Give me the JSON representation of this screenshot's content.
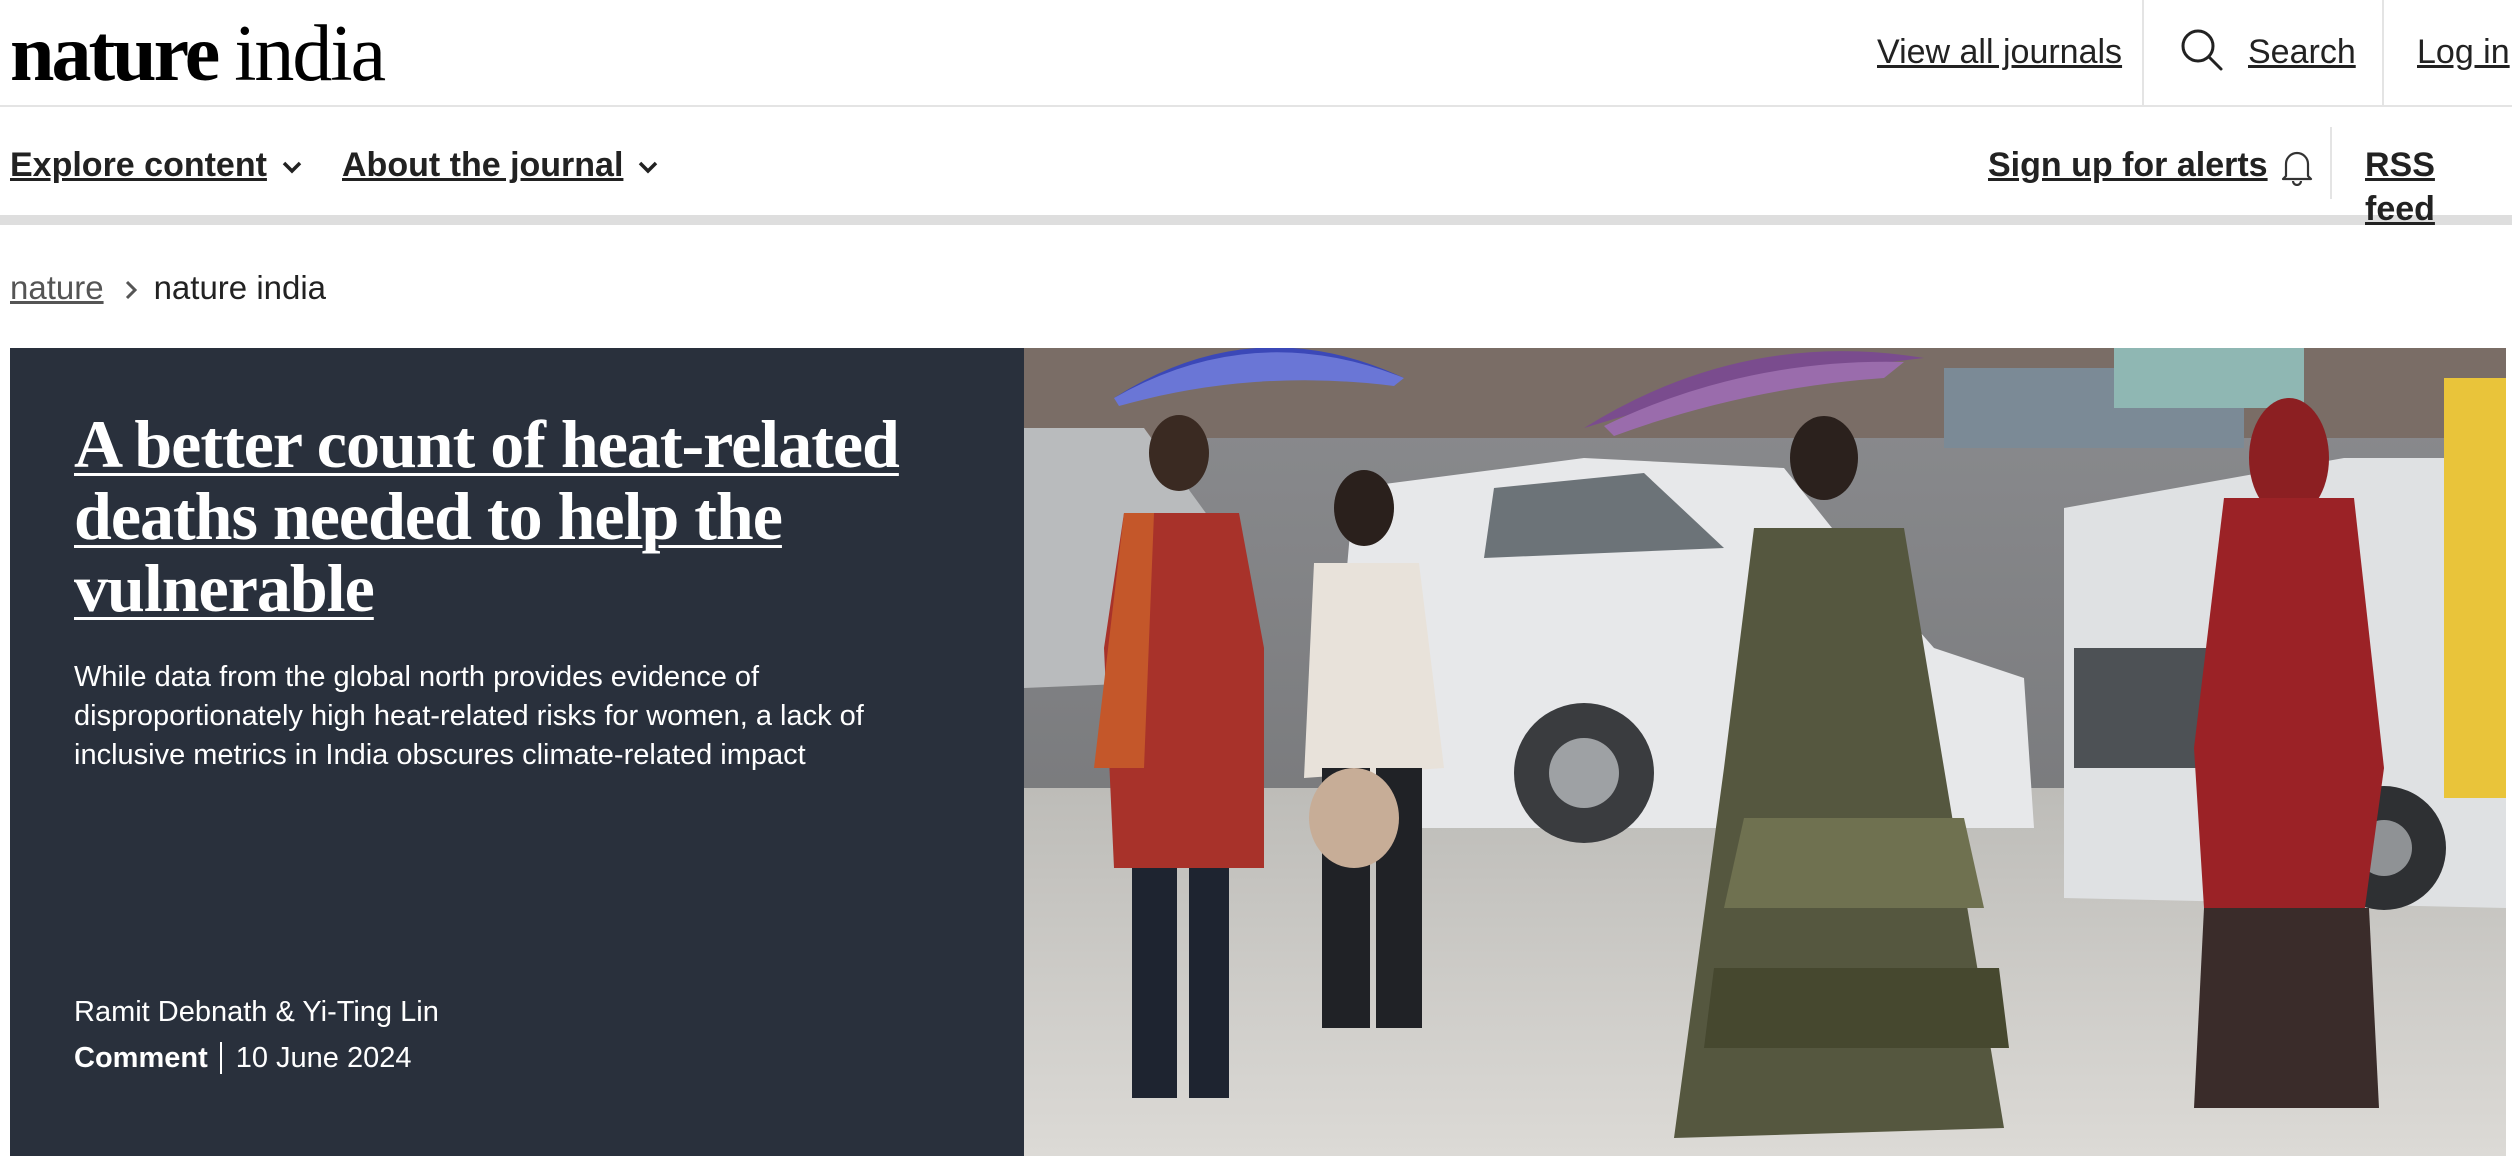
{
  "site": {
    "logo_bold": "nature",
    "logo_light": "india"
  },
  "header": {
    "view_all_journals": "View all journals",
    "search": "Search",
    "login": "Log in"
  },
  "nav": {
    "explore": "Explore content",
    "about": "About the journal",
    "alerts": "Sign up for alerts",
    "rss": "RSS feed"
  },
  "breadcrumb": {
    "parent": "nature",
    "current": "nature india"
  },
  "hero": {
    "title": "A better count of heat-related deaths needed to help the vulnerable",
    "standfirst": "While data from the global north provides evidence of disproportionately high heat-related risks for women, a lack of inclusive metrics in India obscures climate-related impact",
    "authors": "Ramit Debnath & Yi-Ting Lin",
    "article_type": "Comment",
    "date": "10 June 2024"
  },
  "colors": {
    "hero_panel": "#29303c",
    "text": "#222222"
  }
}
